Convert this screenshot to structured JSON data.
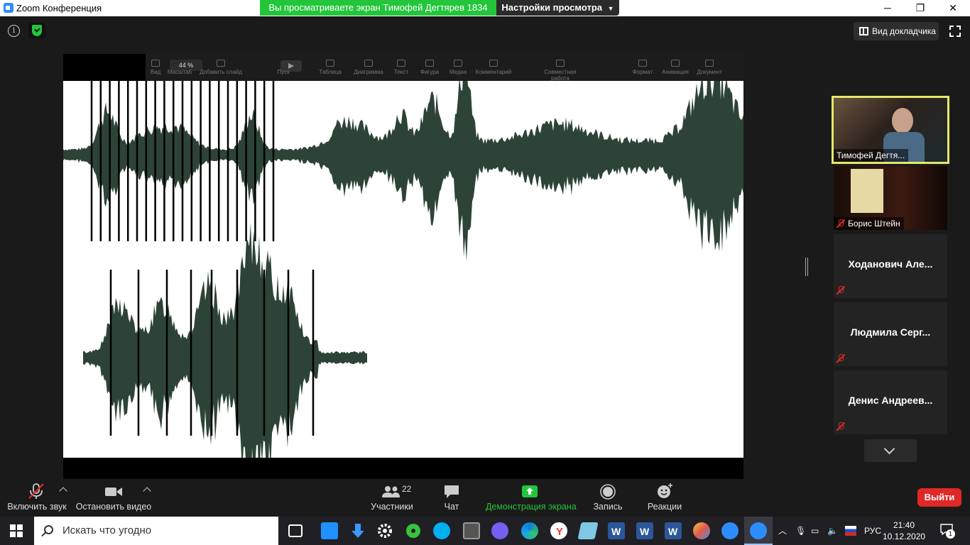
{
  "window": {
    "title": "Zoom Конференция",
    "share_banner": "Вы просматриваете экран Тимофей Дегтярев 1834",
    "view_options": "Настройки просмотра",
    "minimize": "─",
    "maximize": "❐",
    "close": "✕"
  },
  "top_bar": {
    "info_glyph": "i",
    "speaker_view": "Вид докладчика"
  },
  "shared_app_toolbar": {
    "zoom_value": "44 %",
    "items": [
      {
        "label": "Вид",
        "icon": "view-icon"
      },
      {
        "label": "Масштаб",
        "icon": "zoom-icon"
      },
      {
        "label": "Добавить слайд",
        "icon": "add-slide-icon"
      },
      {
        "label": "Пуск",
        "icon": "play-icon"
      },
      {
        "label": "Таблица",
        "icon": "table-icon"
      },
      {
        "label": "Диаграмма",
        "icon": "chart-icon"
      },
      {
        "label": "Текст",
        "icon": "text-icon"
      },
      {
        "label": "Фигура",
        "icon": "shape-icon"
      },
      {
        "label": "Медиа",
        "icon": "media-icon"
      },
      {
        "label": "Комментарий",
        "icon": "comment-icon"
      },
      {
        "label": "Совместная работа",
        "icon": "collaborate-icon"
      },
      {
        "label": "Формат",
        "icon": "format-icon"
      },
      {
        "label": "Анимация",
        "icon": "animation-icon"
      },
      {
        "label": "Документ",
        "icon": "document-icon"
      }
    ]
  },
  "participants": [
    {
      "name": "Тимофей Дегтя...",
      "video": true,
      "active_speaker": true,
      "muted": false
    },
    {
      "name": "Борис Штейн",
      "video": true,
      "active_speaker": false,
      "muted": true
    },
    {
      "name": "Ходанович Але...",
      "video": false,
      "muted": true
    },
    {
      "name": "Людмила Серг...",
      "video": false,
      "muted": true
    },
    {
      "name": "Денис Андреев...",
      "video": false,
      "muted": true
    }
  ],
  "controls": {
    "unmute": "Включить звук",
    "stop_video": "Остановить видео",
    "participants": "Участники",
    "participants_count": "22",
    "chat": "Чат",
    "share_screen": "Демонстрация экрана",
    "record": "Запись",
    "reactions": "Реакции",
    "leave": "Выйти"
  },
  "taskbar": {
    "search_placeholder": "Искать что угодно",
    "language": "РУС",
    "time": "21:40",
    "date": "10.12.2020",
    "notification_count": "1"
  },
  "colors": {
    "accent_green": "#23c53a",
    "danger_red": "#e02828",
    "waveform": "#2d4337",
    "active_speaker_border": "#e6e86a"
  }
}
